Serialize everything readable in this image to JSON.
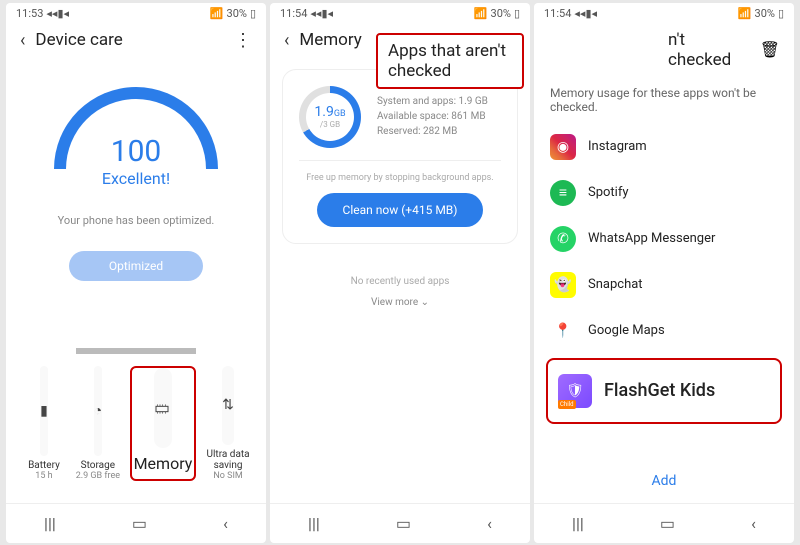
{
  "status": {
    "time1": "11:53",
    "time2": "11:54",
    "time3": "11:54",
    "battery": "30%"
  },
  "screen1": {
    "title": "Device care",
    "score": "100",
    "scoreText": "Excellent!",
    "optimText": "Your phone has been optimized.",
    "btn": "Optimized",
    "tiles": {
      "battery": {
        "label": "Battery",
        "sub": "15 h"
      },
      "storage": {
        "label": "Storage",
        "sub": "2.9 GB free"
      },
      "memory": {
        "label": "Memory"
      },
      "ultra": {
        "label": "Ultra data saving",
        "sub": "No SIM"
      }
    }
  },
  "screen2": {
    "title": "Memory",
    "callout": "Apps that aren't checked",
    "used": "1.9",
    "usedUnit": "GB",
    "total": "/3 GB",
    "stats": {
      "line1": "System and apps: 1.9 GB",
      "line2": "Available space: 861 MB",
      "line3": "Reserved: 282 MB"
    },
    "hint": "Free up memory by stopping background apps.",
    "cleanBtn": "Clean now (+415 MB)",
    "noRecent": "No recently used apps",
    "viewMore": "View more  ⌄"
  },
  "screen3": {
    "title": "n't checked",
    "sub": "Memory usage for these apps won't be checked.",
    "apps": {
      "instagram": "Instagram",
      "spotify": "Spotify",
      "whatsapp": "WhatsApp Messenger",
      "snapchat": "Snapchat",
      "gmaps": "Google Maps",
      "flashget": "FlashGet Kids"
    },
    "childBadge": "Child",
    "add": "Add"
  }
}
